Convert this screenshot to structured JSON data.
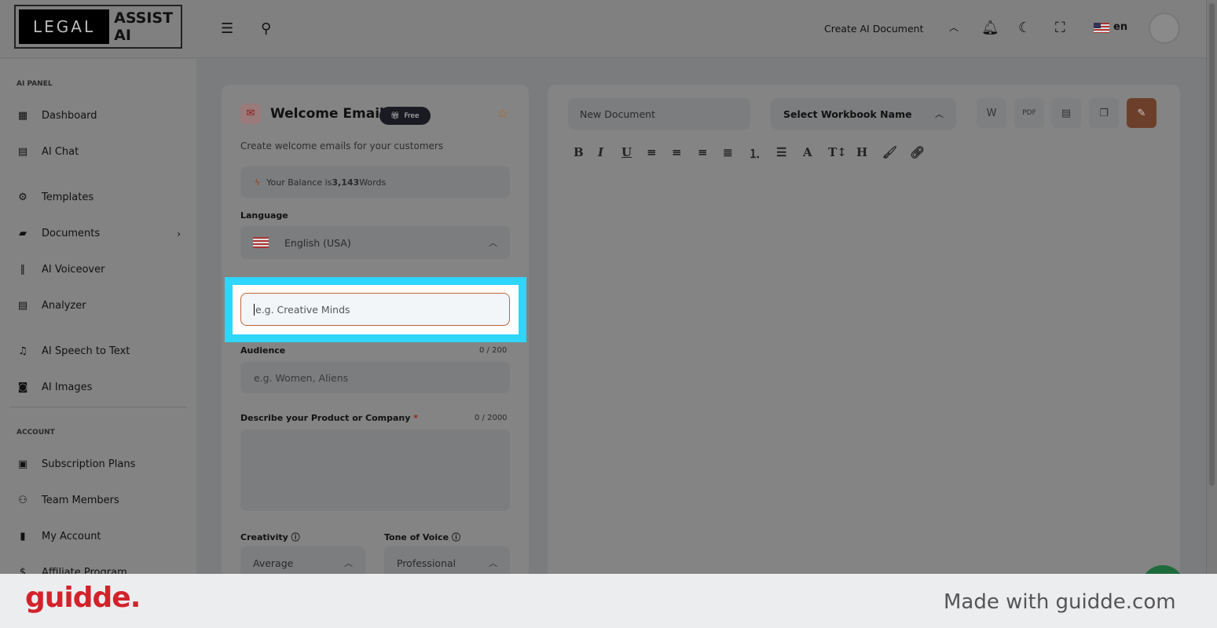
{
  "header": {
    "logo_left": "LEGAL",
    "logo_right": "ASSIST AI",
    "create_doc": "Create AI Document",
    "lang": "en"
  },
  "sidebar": {
    "section_ai": "AI PANEL",
    "items": [
      {
        "label": "Dashboard"
      },
      {
        "label": "AI Chat"
      },
      {
        "label": "Templates"
      },
      {
        "label": "Documents"
      },
      {
        "label": "AI Voiceover"
      },
      {
        "label": "Analyzer"
      },
      {
        "label": "AI Speech to Text"
      },
      {
        "label": "AI Images"
      }
    ],
    "section_account": "ACCOUNT",
    "account_items": [
      {
        "label": "Subscription Plans"
      },
      {
        "label": "Team Members"
      },
      {
        "label": "My Account"
      },
      {
        "label": "Affiliate Program"
      }
    ]
  },
  "form": {
    "title": "Welcome Email",
    "badge": "Free",
    "description": "Create welcome emails for your customers",
    "balance_prefix": "Your Balance is ",
    "balance_value": "3,143",
    "balance_suffix": " Words",
    "language_label": "Language",
    "language_value": "English (USA)",
    "company_placeholder": "e.g. Creative Minds",
    "audience_label": "Audience",
    "audience_count": "0 / 200",
    "audience_placeholder": "e.g. Women, Aliens",
    "describe_label": "Describe your Product or Company",
    "describe_required": "*",
    "describe_count": "0 / 2000",
    "creativity_label": "Creativity",
    "creativity_value": "Average",
    "tone_label": "Tone of Voice",
    "tone_value": "Professional"
  },
  "editor": {
    "doc_name": "New Document",
    "workbook": "Select Workbook Name"
  },
  "footer": {
    "brand": "guidde.",
    "made_with": "Made with guidde.com"
  },
  "colors": {
    "highlight": "#2ed5fc",
    "brand_red": "#d3222a",
    "accent": "#6b3f2a"
  }
}
